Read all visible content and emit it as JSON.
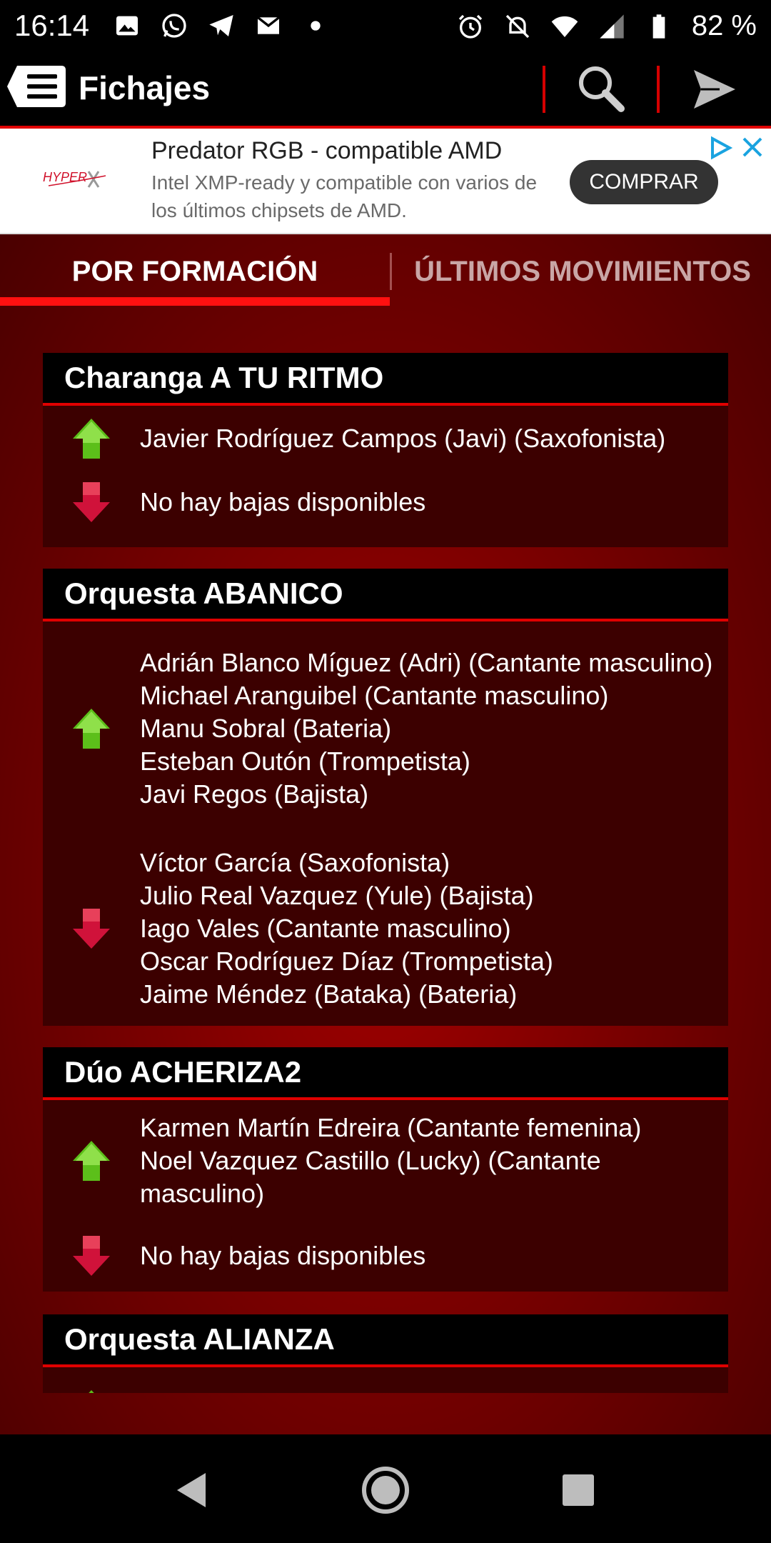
{
  "status_bar": {
    "time": "16:14",
    "battery_percent": "82 %",
    "icons_left": [
      "image-icon",
      "whatsapp-icon",
      "telegram-icon",
      "gmail-icon",
      "dot-icon"
    ],
    "icons_right": [
      "alarm-icon",
      "mute-icon",
      "wifi-icon",
      "signal-icon",
      "battery-icon"
    ]
  },
  "appbar": {
    "title": "Fichajes"
  },
  "ad": {
    "brand": "HYPERX",
    "headline": "Predator RGB - compatible AMD",
    "body": "Intel XMP-ready y compatible con varios de los últimos chipsets de AMD.",
    "cta": "COMPRAR"
  },
  "tabs": [
    {
      "label": "POR FORMACIÓN",
      "active": true
    },
    {
      "label": "ÚLTIMOS MOVIMIENTOS",
      "active": false
    }
  ],
  "groups": [
    {
      "title": "Charanga A TU RITMO",
      "up": [
        "Javier Rodríguez Campos (Javi) (Saxofonista)"
      ],
      "down": [
        "No hay bajas disponibles"
      ]
    },
    {
      "title": "Orquesta ABANICO",
      "up": [
        "Adrián Blanco Míguez (Adri) (Cantante masculino)",
        "Michael Aranguibel (Cantante masculino)",
        "Manu Sobral (Bateria)",
        "Esteban Outón (Trompetista)",
        "Javi Regos (Bajista)"
      ],
      "down": [
        "Víctor García (Saxofonista)",
        "Julio Real Vazquez (Yule) (Bajista)",
        "Iago Vales (Cantante masculino)",
        "Oscar Rodríguez Díaz (Trompetista)",
        "Jaime Méndez (Bataka) (Bateria)"
      ]
    },
    {
      "title": "Dúo ACHERIZA2",
      "up": [
        "Karmen Martín Edreira (Cantante femenina)",
        "Noel Vazquez Castillo (Lucky) (Cantante masculino)"
      ],
      "down": [
        "No hay bajas disponibles"
      ]
    },
    {
      "title": "Orquesta ALIANZA",
      "up": [],
      "down": []
    }
  ],
  "colors": {
    "accent": "#e00000",
    "up_arrow": "#5cbf1a",
    "down_arrow": "#d0123a"
  }
}
